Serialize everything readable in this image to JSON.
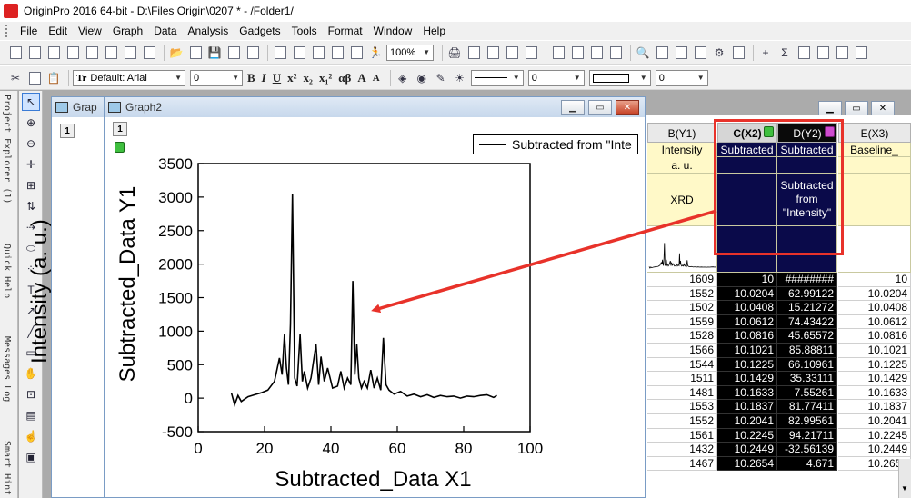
{
  "app": {
    "title": "OriginPro 2016 64-bit - D:\\Files Origin\\0207 * - /Folder1/",
    "zoom": "100%"
  },
  "menu": [
    "File",
    "Edit",
    "View",
    "Graph",
    "Data",
    "Analysis",
    "Gadgets",
    "Tools",
    "Format",
    "Window",
    "Help"
  ],
  "format_toolbar": {
    "font": "Default: Arial",
    "size": "0",
    "buttons": [
      "B",
      "I",
      "U",
      "x²",
      "x₂",
      "x₁²",
      "αβ",
      "A",
      "A"
    ],
    "right_size_1": "0",
    "right_size_2": "0"
  },
  "side_tabs": [
    "Project Explorer (1)",
    "Quick Help",
    "Messages Log",
    "Smart Hint"
  ],
  "windows": {
    "back_title": "Grap",
    "graph_title": "Graph2",
    "layer_label": "1"
  },
  "graph": {
    "legend": "Subtracted from \"Inte",
    "overlay_ylabel": "Intensity (a. u.)"
  },
  "chart_data": {
    "type": "line",
    "xlabel": "Subtracted_Data X1",
    "ylabel": "Subtracted_Data Y1",
    "xlim": [
      0,
      100
    ],
    "ylim": [
      -500,
      3500
    ],
    "xticks": [
      0,
      20,
      40,
      60,
      80,
      100
    ],
    "yticks": [
      -500,
      0,
      500,
      1000,
      1500,
      2000,
      2500,
      3000,
      3500
    ],
    "series": [
      {
        "name": "Subtracted from \"Inte",
        "x": [
          10,
          11,
          12,
          13,
          15,
          17,
          19,
          21,
          23,
          24.5,
          25.3,
          26,
          26.6,
          27.2,
          27.8,
          28.4,
          29.1,
          29.8,
          30.7,
          31.4,
          32,
          33,
          34,
          35.5,
          36.3,
          37,
          38,
          39,
          40.5,
          42,
          43,
          44,
          45,
          46,
          46.6,
          47.2,
          47.8,
          48.4,
          49.2,
          50,
          51,
          52,
          53,
          54,
          55,
          55.8,
          56.6,
          57.5,
          59,
          61,
          63,
          65,
          67,
          69,
          71,
          73,
          75,
          77,
          79,
          81,
          83,
          85,
          87,
          89,
          90
        ],
        "y": [
          80,
          -100,
          40,
          -50,
          20,
          50,
          80,
          120,
          250,
          600,
          350,
          950,
          450,
          200,
          1100,
          3050,
          300,
          180,
          950,
          250,
          400,
          150,
          300,
          800,
          200,
          620,
          250,
          450,
          150,
          180,
          400,
          150,
          300,
          200,
          1750,
          350,
          800,
          300,
          150,
          250,
          150,
          420,
          150,
          300,
          120,
          900,
          200,
          120,
          60,
          100,
          30,
          60,
          20,
          50,
          10,
          40,
          20,
          30,
          0,
          30,
          20,
          40,
          50,
          10,
          40
        ]
      }
    ]
  },
  "sheet": {
    "headers": {
      "b": "B(Y1)",
      "c": "C(X2)",
      "d": "D(Y2)",
      "e": "E(X3)"
    },
    "long_name": {
      "b": "Intensity",
      "c": "Subtracted",
      "d": "Subtracted",
      "e": "Baseline_"
    },
    "units": {
      "b": "a. u."
    },
    "comments": {
      "b": "XRD",
      "d": "Subtracted from \"Intensity\""
    },
    "col_b": [
      "1609",
      "1552",
      "1502",
      "1559",
      "1528",
      "1566",
      "1544",
      "1511",
      "1481",
      "1553",
      "1552",
      "1561",
      "1432",
      "1467"
    ],
    "col_c": [
      "10",
      "10.0204",
      "10.0408",
      "10.0612",
      "10.0816",
      "10.1021",
      "10.1225",
      "10.1429",
      "10.1633",
      "10.1837",
      "10.2041",
      "10.2245",
      "10.2449",
      "10.2654"
    ],
    "col_d": [
      "########",
      "62.99122",
      "15.21272",
      "74.43422",
      "45.65572",
      "85.88811",
      "66.10961",
      "35.33111",
      "7.55261",
      "81.77411",
      "82.99561",
      "94.21711",
      "-32.56139",
      "4.671"
    ],
    "col_e": [
      "10",
      "10.0204",
      "10.0408",
      "10.0612",
      "10.0816",
      "10.1021",
      "10.1225",
      "10.1429",
      "10.1633",
      "10.1837",
      "10.2041",
      "10.2245",
      "10.2449",
      "10.2654"
    ]
  },
  "colors": {
    "selected_col": "#0a0a4a",
    "highlight": "#e8322a",
    "meta_bg": "#fff9c8"
  }
}
